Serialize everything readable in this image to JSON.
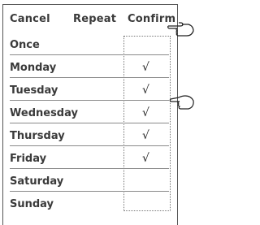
{
  "header": {
    "cancel_label": "Cancel",
    "title": "Repeat",
    "confirm_label": "Confirm"
  },
  "days": [
    {
      "label": "Once",
      "checked": false
    },
    {
      "label": "Monday",
      "checked": true
    },
    {
      "label": "Tuesday",
      "checked": true
    },
    {
      "label": "Wednesday",
      "checked": true
    },
    {
      "label": "Thursday",
      "checked": true
    },
    {
      "label": "Friday",
      "checked": true
    },
    {
      "label": "Saturday",
      "checked": false
    },
    {
      "label": "Sunday",
      "checked": false
    }
  ],
  "check_glyph": "√",
  "icons": {
    "pointer_top": "pointing-hand-icon",
    "pointer_side": "pointing-hand-icon"
  },
  "colors": {
    "text": "#3a3a3a",
    "divider": "#8a8a8a",
    "border": "#555555"
  }
}
